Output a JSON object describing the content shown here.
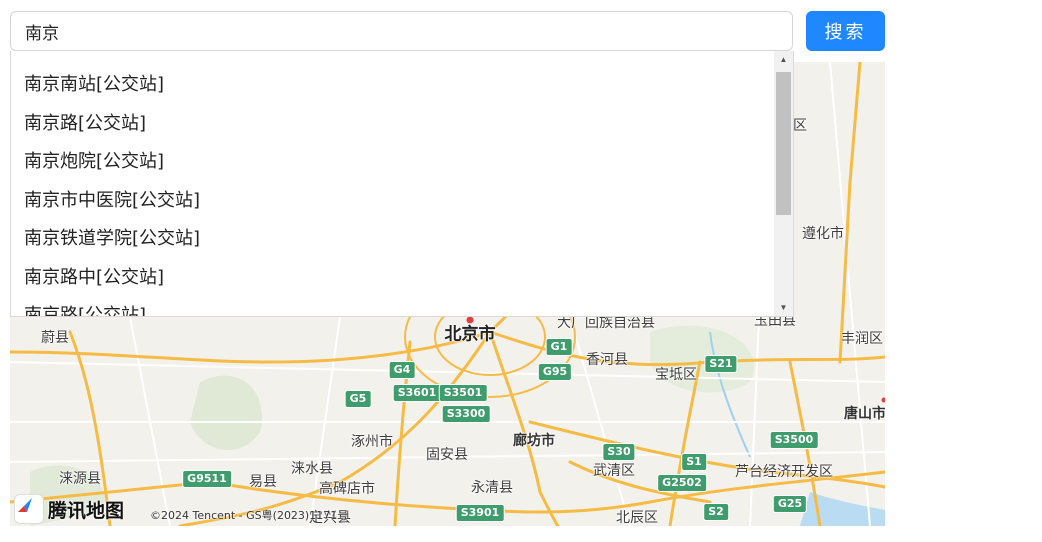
{
  "search": {
    "value": "南京",
    "button_label": "搜索"
  },
  "suggestions": [
    "南京南站[公交站]",
    "南京路[公交站]",
    "南京炮院[公交站]",
    "南京市中医院[公交站]",
    "南京铁道学院[公交站]",
    "南京路中[公交站]",
    "南京路[公交站]"
  ],
  "map": {
    "places": [
      {
        "id": "beijing",
        "text": "北京市",
        "cls": "major"
      },
      {
        "id": "langfang",
        "text": "廊坊市",
        "cls": "mid"
      },
      {
        "id": "tangshan",
        "text": "唐山市",
        "cls": "mid"
      },
      {
        "id": "zhuozhou",
        "text": "涿州市",
        "cls": ""
      },
      {
        "id": "guan",
        "text": "固安县",
        "cls": ""
      },
      {
        "id": "yongqing",
        "text": "永清县",
        "cls": ""
      },
      {
        "id": "wuqing",
        "text": "武清区",
        "cls": ""
      },
      {
        "id": "baodi",
        "text": "宝坻区",
        "cls": ""
      },
      {
        "id": "xianghe",
        "text": "香河县",
        "cls": ""
      },
      {
        "id": "dachang",
        "text": "大厂回族自治县",
        "cls": ""
      },
      {
        "id": "yuxian",
        "text": "蔚县",
        "cls": ""
      },
      {
        "id": "laiyuan",
        "text": "涞源县",
        "cls": ""
      },
      {
        "id": "yixian",
        "text": "易县",
        "cls": ""
      },
      {
        "id": "laishui",
        "text": "涞水县",
        "cls": ""
      },
      {
        "id": "gaobeidian",
        "text": "高碑店市",
        "cls": ""
      },
      {
        "id": "beichen",
        "text": "北辰区",
        "cls": ""
      },
      {
        "id": "dingxing",
        "text": "定兴县",
        "cls": ""
      },
      {
        "id": "lutai",
        "text": "芦台经济开发区",
        "cls": ""
      },
      {
        "id": "zunhua",
        "text": "遵化市",
        "cls": ""
      },
      {
        "id": "yutian",
        "text": "玉田县",
        "cls": ""
      },
      {
        "id": "fengrun",
        "text": "丰润区",
        "cls": ""
      },
      {
        "id": "district",
        "text": "区",
        "cls": ""
      }
    ],
    "shields": [
      {
        "id": "g4",
        "text": "G4"
      },
      {
        "id": "g5",
        "text": "G5"
      },
      {
        "id": "g1",
        "text": "G1"
      },
      {
        "id": "g95",
        "text": "G95"
      },
      {
        "id": "s21",
        "text": "S21"
      },
      {
        "id": "s3601",
        "text": "S3601"
      },
      {
        "id": "s3501",
        "text": "S3501"
      },
      {
        "id": "s3300",
        "text": "S3300"
      },
      {
        "id": "s30",
        "text": "S30"
      },
      {
        "id": "s1",
        "text": "S1"
      },
      {
        "id": "g2502",
        "text": "G2502"
      },
      {
        "id": "s3500",
        "text": "S3500"
      },
      {
        "id": "g9511",
        "text": "G9511"
      },
      {
        "id": "s3901",
        "text": "S3901"
      },
      {
        "id": "s2",
        "text": "S2"
      },
      {
        "id": "g25",
        "text": "G25"
      }
    ],
    "logo_text": "腾讯地图",
    "copyright": "©2024 Tencent - GS粤(2023)1171号"
  },
  "colors": {
    "accent": "#1f87ff",
    "map_bg": "#f3f1ec",
    "road_major": "#f6bb45",
    "shield": "#3f9c6c"
  }
}
